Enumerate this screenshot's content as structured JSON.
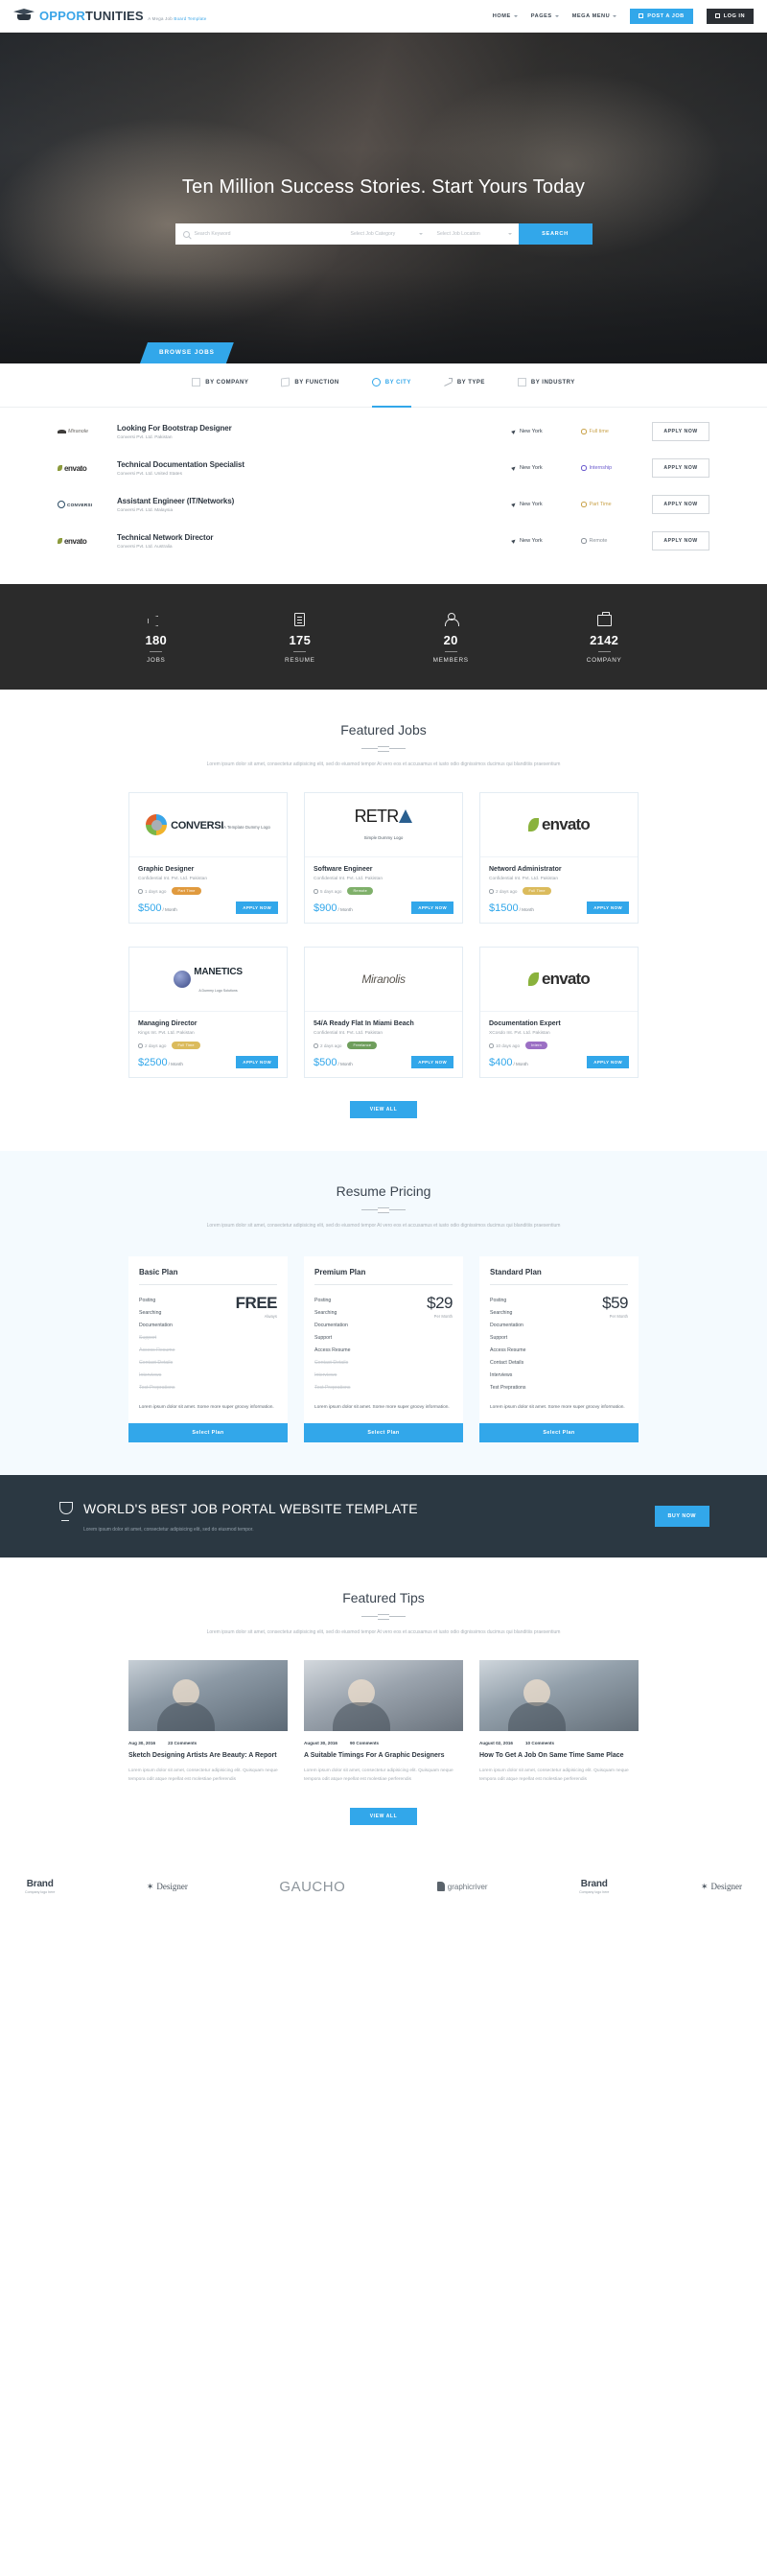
{
  "header": {
    "logo": {
      "part1": "OPPOR",
      "part2": "TUNITIES",
      "tagline_a": "A Mega Job ",
      "tagline_b": "Board Template"
    },
    "nav": [
      {
        "label": "HOME",
        "has_caret": true
      },
      {
        "label": "PAGES",
        "has_caret": true
      },
      {
        "label": "MEGA MENU",
        "has_caret": true
      }
    ],
    "post_job_label": "POST A JOB",
    "login_label": "LOG IN"
  },
  "hero": {
    "title": "Ten Million Success Stories. Start Yours Today",
    "search": {
      "keyword_placeholder": "Search Keyword",
      "category_placeholder": "Select Job Category",
      "location_placeholder": "Select Job Location",
      "button_label": "SEARCH"
    },
    "browse_tab_label": "BROWSE JOBS"
  },
  "filters": [
    {
      "label": "BY COMPANY",
      "icon": "bookmark-icon",
      "active": false
    },
    {
      "label": "BY FUNCTION",
      "icon": "layers-icon",
      "active": false
    },
    {
      "label": "BY CITY",
      "icon": "globe-icon",
      "active": true
    },
    {
      "label": "BY TYPE",
      "icon": "trend-icon",
      "active": false
    },
    {
      "label": "BY INDUSTRY",
      "icon": "inbox-icon",
      "active": false
    }
  ],
  "job_list": [
    {
      "logo": "miranole",
      "title": "Looking For Bootstrap Designer",
      "company": "Conversi Pvt. Ltd. Pakistan",
      "location": "New York",
      "type": "Full time",
      "type_color": "#c9a24a",
      "apply_label": "APPLY NOW"
    },
    {
      "logo": "envato",
      "title": "Technical Documentation Specialist",
      "company": "Conversi Pvt. Ltd. United States",
      "location": "New York",
      "type": "Internship",
      "type_color": "#6a5acd",
      "apply_label": "APPLY NOW"
    },
    {
      "logo": "conversi",
      "title": "Assistant Engineer (IT/Networks)",
      "company": "Conversi Pvt. Ltd. Malaysia",
      "location": "New York",
      "type": "Part Time",
      "type_color": "#c9a24a",
      "apply_label": "APPLY NOW"
    },
    {
      "logo": "envato",
      "title": "Technical Network Director",
      "company": "Conversi Pvt. Ltd. Australia",
      "location": "New York",
      "type": "Remote",
      "type_color": "#8a9199",
      "apply_label": "APPLY NOW"
    }
  ],
  "stats": [
    {
      "icon": "megaphone-icon",
      "number": "180",
      "label": "JOBS"
    },
    {
      "icon": "document-icon",
      "number": "175",
      "label": "RESUME"
    },
    {
      "icon": "user-icon",
      "number": "20",
      "label": "MEMBERS"
    },
    {
      "icon": "briefcase-icon",
      "number": "2142",
      "label": "COMPANY"
    }
  ],
  "featured_jobs": {
    "title": "Featured Jobs",
    "description": "Lorem ipsum dolor sit amet, consectetur adipisicing elit, sed do eiusmod tempor At vero eos et accusamus et iusto odio dignissimos ducimus qui blanditiis praesentium",
    "view_all_label": "VIEW ALL",
    "cards": [
      {
        "logo": "conversi",
        "logo_title": "CONVERSI",
        "logo_sub": "A Template Dummy Logo",
        "title": "Graphic Designer",
        "company": "Confidential Int. Pvt. Ltd. Pakistan",
        "ago": "1 days ago",
        "badge": "Part Time",
        "badge_color": "#e09a3e",
        "price": "$500",
        "price_unit": "/ Month",
        "apply_label": "APPLY NOW"
      },
      {
        "logo": "retra",
        "logo_title": "RETRA",
        "logo_sub": "Simple Dummy Logo",
        "title": "Software Engineer",
        "company": "Confidential Int. Pvt. Ltd. Pakistan",
        "ago": "5 days ago",
        "badge": "Remote",
        "badge_color": "#7fb06a",
        "price": "$900",
        "price_unit": "/ Month",
        "apply_label": "APPLY NOW"
      },
      {
        "logo": "envato",
        "logo_title": "envato",
        "logo_sub": "",
        "title": "Netword Administrator",
        "company": "Confidential Int. Pvt. Ltd. Pakistan",
        "ago": "2 days ago",
        "badge": "Full Time",
        "badge_color": "#dbbb5c",
        "price": "$1500",
        "price_unit": "/ Month",
        "apply_label": "APPLY NOW"
      },
      {
        "logo": "manetics",
        "logo_title": "MANETICS",
        "logo_sub": "A Dummy Logo Solutions",
        "title": "Managing Director",
        "company": "Kings Int. Pvt. Ltd. Pakistan",
        "ago": "2 days ago",
        "badge": "Full Time",
        "badge_color": "#dbbb5c",
        "price": "$2500",
        "price_unit": "/ Month",
        "apply_label": "APPLY NOW"
      },
      {
        "logo": "miranole",
        "logo_title": "Miranolis",
        "logo_sub": "",
        "title": "54/A Ready Flat In Miami Beach",
        "company": "Confidential Int. Pvt. Ltd. Pakistan",
        "ago": "2 days ago",
        "badge": "Freelance",
        "badge_color": "#6f9e5c",
        "price": "$500",
        "price_unit": "/ Month",
        "apply_label": "APPLY NOW"
      },
      {
        "logo": "envato",
        "logo_title": "envato",
        "logo_sub": "",
        "title": "Documentation Expert",
        "company": "XCosdo Int. Pvt. Ltd. Pakistan",
        "ago": "10 days ago",
        "badge": "Intern",
        "badge_color": "#9b6fc4",
        "price": "$400",
        "price_unit": "/ Month",
        "apply_label": "APPLY NOW"
      }
    ]
  },
  "pricing": {
    "title": "Resume Pricing",
    "description": "Lorem ipsum dolor sit amet, consectetur adipisicing elit, sed do eiusmod tempor At vero eos et accusamus et iusto odio dignissimos ducimus qui blanditiis praesentium",
    "note": "Lorem ipsum dolor sit amet. Some more super groovy information.",
    "select_label": "Select Plan",
    "plans": [
      {
        "name": "Basic Plan",
        "price": "FREE",
        "unit": "Always",
        "price_style": "word",
        "features": [
          {
            "label": "Posting",
            "enabled": true
          },
          {
            "label": "Searching",
            "enabled": true
          },
          {
            "label": "Documentation",
            "enabled": true
          },
          {
            "label": "Support",
            "enabled": false
          },
          {
            "label": "Access Resume",
            "enabled": false
          },
          {
            "label": "Contact Details",
            "enabled": false
          },
          {
            "label": "Interviews",
            "enabled": false
          },
          {
            "label": "Test Preprations",
            "enabled": false
          }
        ]
      },
      {
        "name": "Premium Plan",
        "price": "$29",
        "unit": "Per Month",
        "price_style": "num",
        "features": [
          {
            "label": "Posting",
            "enabled": true
          },
          {
            "label": "Searching",
            "enabled": true
          },
          {
            "label": "Documentation",
            "enabled": true
          },
          {
            "label": "Support",
            "enabled": true
          },
          {
            "label": "Access Resume",
            "enabled": true
          },
          {
            "label": "Contact Details",
            "enabled": false
          },
          {
            "label": "Interviews",
            "enabled": false
          },
          {
            "label": "Test Preprations",
            "enabled": false
          }
        ]
      },
      {
        "name": "Standard Plan",
        "price": "$59",
        "unit": "Per Month",
        "price_style": "num",
        "features": [
          {
            "label": "Posting",
            "enabled": true
          },
          {
            "label": "Searching",
            "enabled": true
          },
          {
            "label": "Documentation",
            "enabled": true
          },
          {
            "label": "Support",
            "enabled": true
          },
          {
            "label": "Access Resume",
            "enabled": true
          },
          {
            "label": "Contact Details",
            "enabled": true
          },
          {
            "label": "Interviews",
            "enabled": true
          },
          {
            "label": "Test Preprations",
            "enabled": true
          }
        ]
      }
    ]
  },
  "cta": {
    "heading": "WORLD'S BEST JOB PORTAL WEBSITE TEMPLATE",
    "subtext": "Lorem ipsum dolor sit amet, consectetur adipisicing elit, sed do eiusmod tempor.",
    "button_label": "BUY NOW"
  },
  "tips": {
    "title": "Featured Tips",
    "description": "Lorem ipsum dolor sit amet, consectetur adipisicing elit, sed do eiusmod tempor At vero eos et accusamus et iusto odio dignissimos ducimus qui blanditiis praesentium",
    "view_all_label": "VIEW ALL",
    "posts": [
      {
        "date": "Aug 30, 2016",
        "comments": "23 Comments",
        "title": "Sketch Designing Artists Are Beauty: A Report",
        "excerpt": "Lorem ipsum dolor sit amet, consectetur adipisicing elit. Quisquam neque tempora odit atque repellat est molestiae perferendis"
      },
      {
        "date": "August 30, 2016",
        "comments": "90 Comments",
        "title": "A Suitable Timings For A Graphic Designers",
        "excerpt": "Lorem ipsum dolor sit amet, consectetur adipisicing elit. Quisquam neque tempora odit atque repellat est molestiae perferendis"
      },
      {
        "date": "August 02, 2016",
        "comments": "10 Comments",
        "title": "How To Get A Job On Same Time Same Place",
        "excerpt": "Lorem ipsum dolor sit amet, consectetur adipisicing elit. Quisquam neque tempora odit atque repellat est molestiae perferendis"
      }
    ]
  },
  "brands": [
    {
      "type": "brand",
      "name": "Brand",
      "sub": "Company logo here"
    },
    {
      "type": "designer",
      "name": "Designer"
    },
    {
      "type": "gaucho",
      "name": "GAUCHO"
    },
    {
      "type": "graphic",
      "name": "graphicriver"
    },
    {
      "type": "brand",
      "name": "Brand",
      "sub": "Company logo here"
    },
    {
      "type": "designer",
      "name": "Designer"
    }
  ],
  "colors": {
    "accent": "#32a7ea",
    "dark": "#2b2b2b",
    "cta_bg": "#2b3842"
  }
}
